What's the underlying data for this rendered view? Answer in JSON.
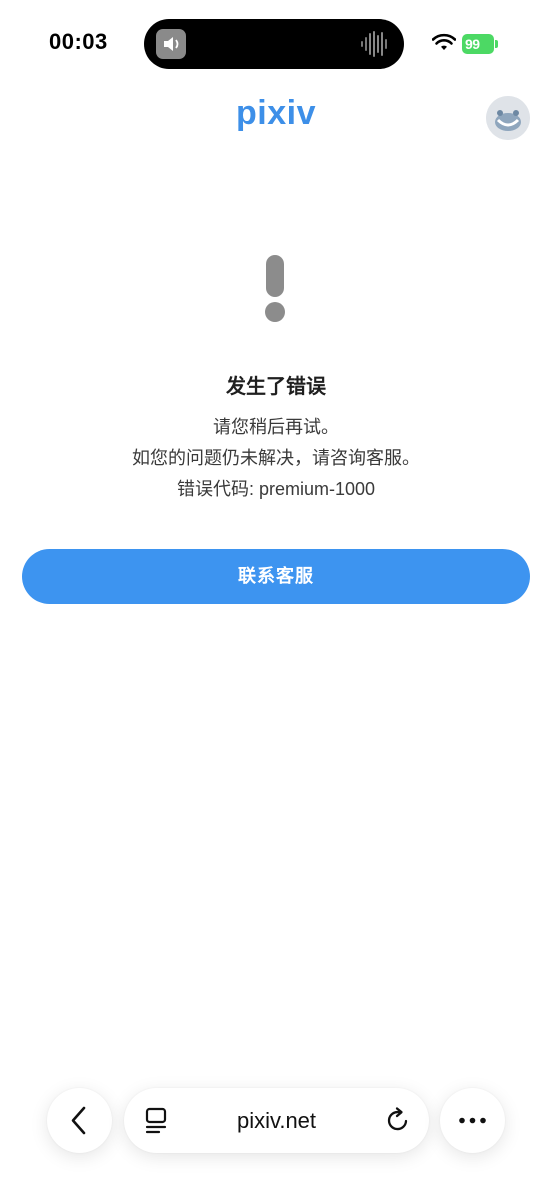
{
  "status_bar": {
    "time": "00:03",
    "battery": "99"
  },
  "header": {
    "logo": "pixiv",
    "avatar_icon": "avatar-icon"
  },
  "error": {
    "title": "发生了错误",
    "line1": "请您稍后再试。",
    "line2": "如您的问题仍未解决，请咨询客服。",
    "line3": "错误代码: premium-1000"
  },
  "actions": {
    "contact_label": "联系客服"
  },
  "browser_bar": {
    "address": "pixiv.net"
  },
  "colors": {
    "accent": "#3d94f0",
    "logo": "#3d8fe8",
    "battery": "#4cd964"
  }
}
